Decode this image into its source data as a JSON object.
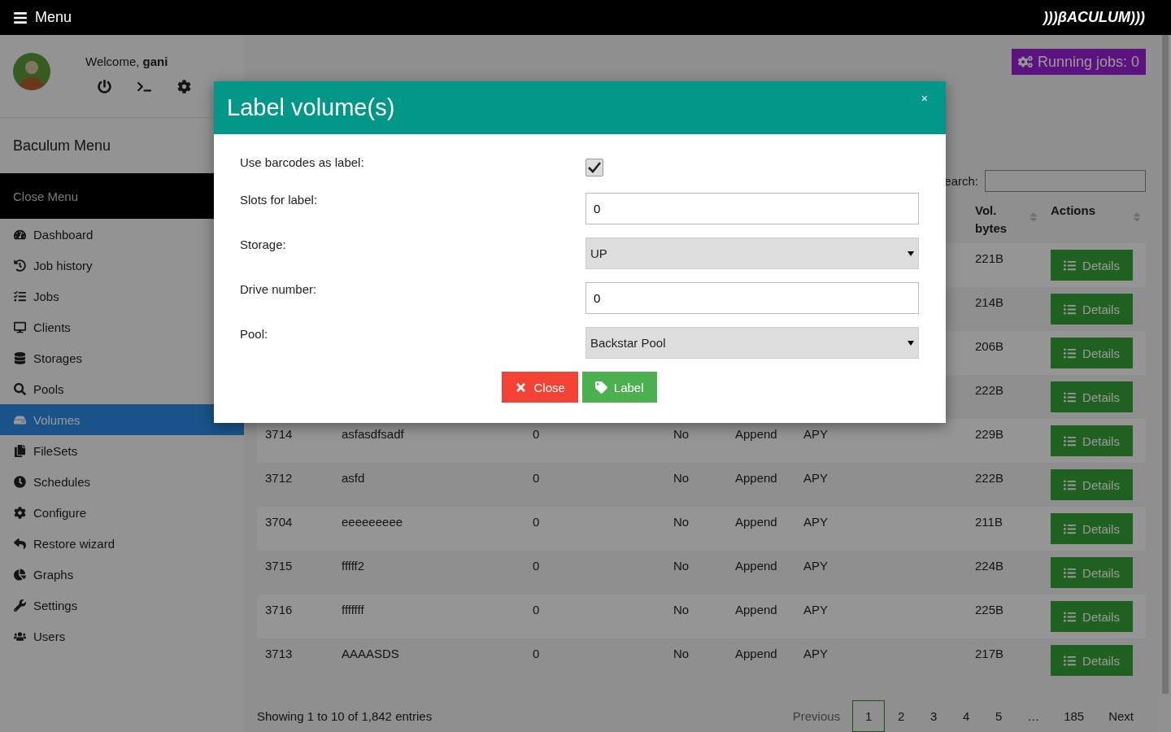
{
  "topbar": {
    "menu_label": "Menu",
    "logo": ")))βACULUM)))"
  },
  "sidebar": {
    "welcome": "Welcome, **gani**",
    "title": "Baculum Menu",
    "close_label": "Close Menu",
    "items": [
      {
        "label": "Dashboard",
        "selected": false
      },
      {
        "label": "Job history",
        "selected": false
      },
      {
        "label": "Jobs",
        "selected": false
      },
      {
        "label": "Clients",
        "selected": false
      },
      {
        "label": "Storages",
        "selected": false
      },
      {
        "label": "Pools",
        "selected": false
      },
      {
        "label": "Volumes",
        "selected": true
      },
      {
        "label": "FileSets",
        "selected": false
      },
      {
        "label": "Schedules",
        "selected": false
      },
      {
        "label": "Configure",
        "selected": false
      },
      {
        "label": "Restore wizard",
        "selected": false
      },
      {
        "label": "Graphs",
        "selected": false
      },
      {
        "label": "Settings",
        "selected": false
      },
      {
        "label": "Users",
        "selected": false
      }
    ]
  },
  "running_jobs": "Running jobs: 0",
  "search_label": "earch:",
  "table": {
    "columns": [
      "Vol. bytes",
      "Actions"
    ],
    "rows": [
      {
        "bytes": "221B",
        "action": "Details"
      },
      {
        "bytes": "214B",
        "action": "Details"
      },
      {
        "bytes": "206B",
        "action": "Details"
      },
      {
        "bytes": "222B",
        "action": "Details"
      },
      {
        "id": "3714",
        "name": "asfasdfsadf",
        "column_3": "0",
        "column_4": "No",
        "column_5": "Append",
        "column_6": "APY",
        "bytes": "229B",
        "action": "Details"
      },
      {
        "id": "3712",
        "name": "asfd",
        "column_3": "0",
        "column_4": "No",
        "column_5": "Append",
        "column_6": "APY",
        "bytes": "222B",
        "action": "Details"
      },
      {
        "id": "3704",
        "name": "eeeeeeeee",
        "column_3": "0",
        "column_4": "No",
        "column_5": "Append",
        "column_6": "APY",
        "bytes": "211B",
        "action": "Details"
      },
      {
        "id": "3715",
        "name": "fffff2",
        "column_3": "0",
        "column_4": "No",
        "column_5": "Append",
        "column_6": "APY",
        "bytes": "224B",
        "action": "Details"
      },
      {
        "id": "3716",
        "name": "fffffff",
        "column_3": "0",
        "column_4": "No",
        "column_5": "Append",
        "column_6": "APY",
        "bytes": "225B",
        "action": "Details"
      },
      {
        "id": "3713",
        "name": "AAAASDS",
        "column_3": "0",
        "column_4": "No",
        "column_5": "Append",
        "column_6": "APY",
        "bytes": "217B",
        "action": "Details"
      }
    ]
  },
  "footer": {
    "info": "Showing 1 to 10 of 1,842 entries",
    "previous": "Previous",
    "next": "Next",
    "pages": [
      {
        "label": "1",
        "selected": true
      },
      {
        "label": "2",
        "selected": false
      },
      {
        "label": "3",
        "selected": false
      },
      {
        "label": "4",
        "selected": false
      },
      {
        "label": "5",
        "selected": false
      },
      {
        "label": "…",
        "selected": false
      },
      {
        "label": "185",
        "selected": false
      }
    ]
  },
  "modal": {
    "title": "Label volume(s)",
    "close_symbol": "×",
    "fields": [
      {
        "kind": "checkbox",
        "label": "Use barcodes as label:",
        "checked": true
      },
      {
        "kind": "text",
        "label": "Slots for label:",
        "value": "0"
      },
      {
        "kind": "select",
        "label": "Storage:",
        "value": "UP"
      },
      {
        "kind": "text",
        "label": "Drive number:",
        "value": "0"
      },
      {
        "kind": "select",
        "label": "Pool:",
        "value": "Backstar Pool"
      }
    ],
    "buttons": [
      {
        "kind": "close",
        "label": "Close"
      },
      {
        "kind": "label",
        "label": "Label"
      }
    ]
  }
}
